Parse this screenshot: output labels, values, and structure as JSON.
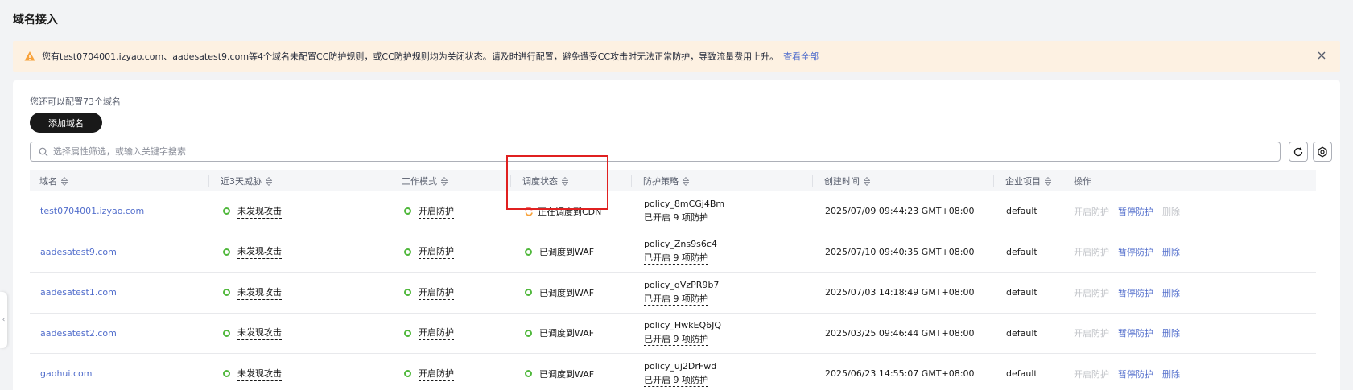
{
  "page": {
    "title": "域名接入"
  },
  "alert": {
    "message": "您有test0704001.izyao.com、aadesatest9.com等4个域名未配置CC防护规则，或CC防护规则均为关闭状态。请及时进行配置，避免遭受CC攻击时无法正常防护，导致流量费用上升。",
    "link": "查看全部"
  },
  "toolbar": {
    "quota": "您还可以配置73个域名",
    "add_label": "添加域名",
    "search_placeholder": "选择属性筛选，或输入关键字搜索"
  },
  "table": {
    "headers": {
      "domain": "域名",
      "threat": "近3天威胁",
      "mode": "工作模式",
      "dispatch": "调度状态",
      "policy": "防护策略",
      "created": "创建时间",
      "project": "企业项目",
      "ops": "操作"
    },
    "rows": [
      {
        "domain": "test0704001.izyao.com",
        "threat": "未发现攻击",
        "mode": "开启防护",
        "dispatch": "正在调度到CDN",
        "policy": "policy_8mCGj4Bm",
        "policy_sub": "已开启 9 项防护",
        "created": "2025/07/09 09:44:23 GMT+08:00",
        "project": "default",
        "op1": "开启防护",
        "op2": "暂停防护",
        "op3": "删除"
      },
      {
        "domain": "aadesatest9.com",
        "threat": "未发现攻击",
        "mode": "开启防护",
        "dispatch": "已调度到WAF",
        "policy": "policy_Zns9s6c4",
        "policy_sub": "已开启 9 项防护",
        "created": "2025/07/10 09:40:35 GMT+08:00",
        "project": "default",
        "op1": "开启防护",
        "op2": "暂停防护",
        "op3": "删除"
      },
      {
        "domain": "aadesatest1.com",
        "threat": "未发现攻击",
        "mode": "开启防护",
        "dispatch": "已调度到WAF",
        "policy": "policy_qVzPR9b7",
        "policy_sub": "已开启 9 项防护",
        "created": "2025/07/03 14:18:49 GMT+08:00",
        "project": "default",
        "op1": "开启防护",
        "op2": "暂停防护",
        "op3": "删除"
      },
      {
        "domain": "aadesatest2.com",
        "threat": "未发现攻击",
        "mode": "开启防护",
        "dispatch": "已调度到WAF",
        "policy": "policy_HwkEQ6JQ",
        "policy_sub": "已开启 9 项防护",
        "created": "2025/03/25 09:46:44 GMT+08:00",
        "project": "default",
        "op1": "开启防护",
        "op2": "暂停防护",
        "op3": "删除"
      },
      {
        "domain": "gaohui.com",
        "threat": "未发现攻击",
        "mode": "开启防护",
        "dispatch": "已调度到WAF",
        "policy": "policy_uj2DrFwd",
        "policy_sub": "已开启 9 项防护",
        "created": "2025/06/23 14:55:07 GMT+08:00",
        "project": "default",
        "op1": "开启防护",
        "op2": "暂停防护",
        "op3": "删除"
      }
    ]
  },
  "colors": {
    "accent": "#526ecc",
    "success": "#50b83c",
    "warning": "#f66f6a",
    "highlight": "#e02020"
  },
  "icons": [
    "warning-icon",
    "close-icon",
    "search-icon",
    "refresh-icon",
    "settings-icon",
    "sort-icon",
    "status-dot-icon",
    "dispatching-icon",
    "collapse-arrow-icon"
  ]
}
